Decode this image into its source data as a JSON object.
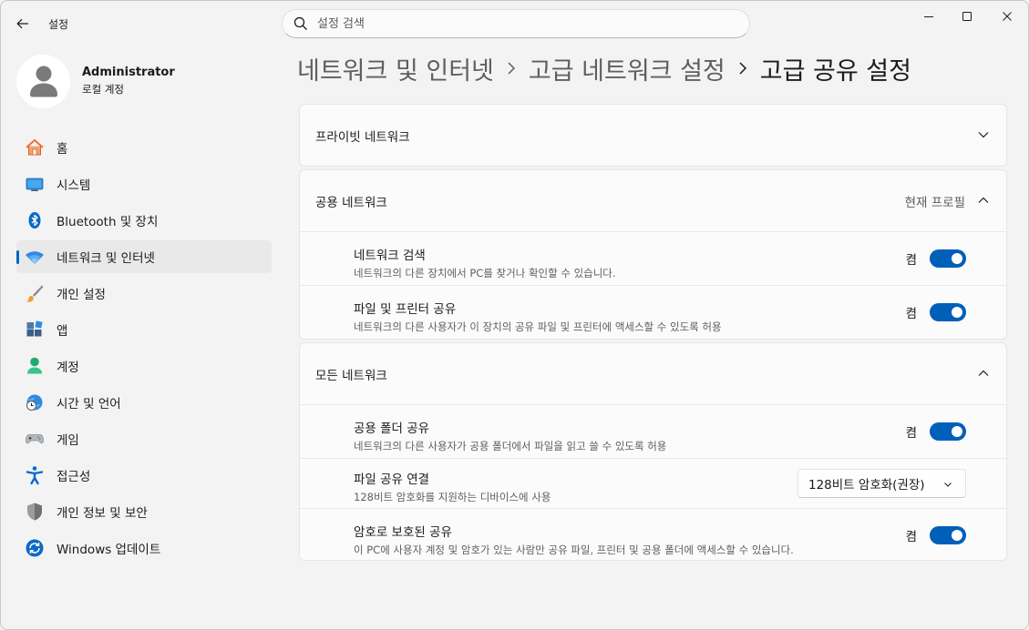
{
  "window": {
    "app_title": "설정"
  },
  "search": {
    "placeholder": "설정 검색"
  },
  "profile": {
    "name": "Administrator",
    "account_type": "로컬 계정"
  },
  "sidebar": {
    "items": [
      {
        "label": "홈",
        "icon": "home-icon"
      },
      {
        "label": "시스템",
        "icon": "system-icon"
      },
      {
        "label": "Bluetooth 및 장치",
        "icon": "bluetooth-icon"
      },
      {
        "label": "네트워크 및 인터넷",
        "icon": "wifi-icon",
        "active": true
      },
      {
        "label": "개인 설정",
        "icon": "brush-icon"
      },
      {
        "label": "앱",
        "icon": "apps-icon"
      },
      {
        "label": "계정",
        "icon": "account-icon"
      },
      {
        "label": "시간 및 언어",
        "icon": "time-language-icon"
      },
      {
        "label": "게임",
        "icon": "gaming-icon"
      },
      {
        "label": "접근성",
        "icon": "accessibility-icon"
      },
      {
        "label": "개인 정보 및 보안",
        "icon": "shield-icon"
      },
      {
        "label": "Windows 업데이트",
        "icon": "update-icon"
      }
    ]
  },
  "breadcrumb": {
    "items": [
      "네트워크 및 인터넷",
      "고급 네트워크 설정"
    ],
    "current": "고급 공유 설정"
  },
  "sections": {
    "private": {
      "title": "프라이빗 네트워크",
      "expanded": false
    },
    "public": {
      "title": "공용 네트워크",
      "tag": "현재 프로필",
      "expanded": true,
      "rows": [
        {
          "title": "네트워크 검색",
          "desc": "네트워크의 다른 장치에서 PC를 찾거나 확인할 수 있습니다.",
          "state_label": "켬",
          "on": true
        },
        {
          "title": "파일 및 프린터 공유",
          "desc": "네트워크의 다른 사용자가 이 장치의 공유 파일 및 프린터에 액세스할 수 있도록 허용",
          "state_label": "켬",
          "on": true
        }
      ]
    },
    "all": {
      "title": "모든 네트워크",
      "expanded": true,
      "rows": [
        {
          "title": "공용 폴더 공유",
          "desc": "네트워크의 다른 사용자가 공용 폴더에서 파일을 읽고 쓸 수 있도록 허용",
          "state_label": "켬",
          "on": true
        },
        {
          "title": "파일 공유 연결",
          "desc": "128비트 암호화를 지원하는 디바이스에 사용",
          "dropdown_value": "128비트 암호화(권장)"
        },
        {
          "title": "암호로 보호된 공유",
          "desc": "이 PC에 사용자 계정 및 암호가 있는 사람만 공유 파일, 프린터 및 공용 폴더에 액세스할 수 있습니다.",
          "state_label": "켬",
          "on": true
        }
      ]
    }
  },
  "colors": {
    "accent": "#005fb8",
    "background": "#f3f3f3",
    "card": "#fbfbfb"
  }
}
